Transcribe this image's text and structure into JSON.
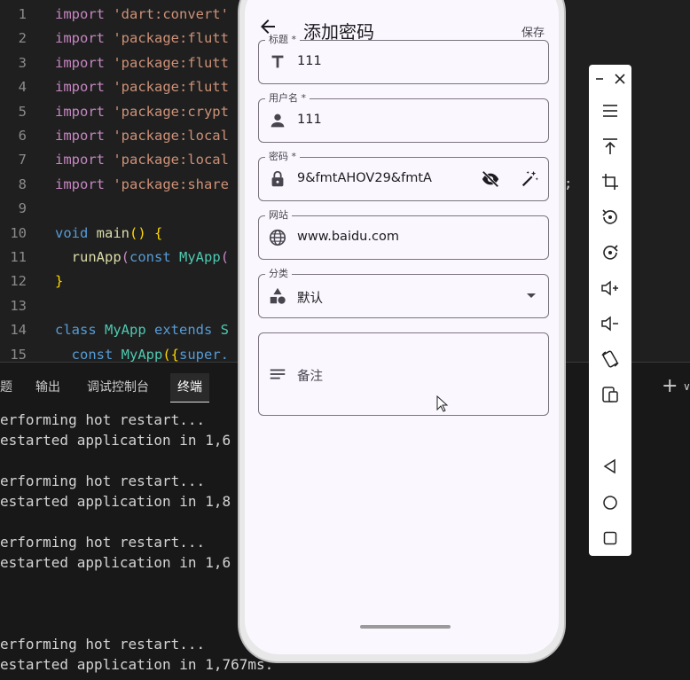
{
  "editor": {
    "lines": [
      {
        "n": "1",
        "parts": [
          [
            "kw",
            "import "
          ],
          [
            "str",
            "'dart:convert'"
          ]
        ]
      },
      {
        "n": "2",
        "parts": [
          [
            "kw",
            "import "
          ],
          [
            "str",
            "'package:flutt"
          ]
        ]
      },
      {
        "n": "3",
        "parts": [
          [
            "kw",
            "import "
          ],
          [
            "str",
            "'package:flutt"
          ]
        ]
      },
      {
        "n": "4",
        "parts": [
          [
            "kw",
            "import "
          ],
          [
            "str",
            "'package:flutt"
          ]
        ]
      },
      {
        "n": "5",
        "parts": [
          [
            "kw",
            "import "
          ],
          [
            "str",
            "'package:crypt"
          ]
        ]
      },
      {
        "n": "6",
        "parts": [
          [
            "kw",
            "import "
          ],
          [
            "str",
            "'package:local"
          ]
        ]
      },
      {
        "n": "7",
        "parts": [
          [
            "kw",
            "import "
          ],
          [
            "str",
            "'package:local"
          ]
        ]
      },
      {
        "n": "8",
        "parts": [
          [
            "kw",
            "import "
          ],
          [
            "str",
            "'package:share"
          ]
        ]
      },
      {
        "n": "9",
        "parts": []
      },
      {
        "n": "10",
        "parts": [
          [
            "kw2",
            "void "
          ],
          [
            "fn",
            "main"
          ],
          [
            "br",
            "() {"
          ]
        ]
      },
      {
        "n": "11",
        "parts": [
          [
            "txt",
            "  "
          ],
          [
            "fn",
            "runApp"
          ],
          [
            "kw",
            "("
          ],
          [
            "kw2",
            "const "
          ],
          [
            "cls",
            "MyApp"
          ],
          [
            "kw",
            "("
          ]
        ]
      },
      {
        "n": "12",
        "parts": [
          [
            "br",
            "}"
          ]
        ]
      },
      {
        "n": "13",
        "parts": []
      },
      {
        "n": "14",
        "parts": [
          [
            "kw2",
            "class "
          ],
          [
            "cls",
            "MyApp "
          ],
          [
            "kw2",
            "extends "
          ],
          [
            "cls",
            "S"
          ]
        ]
      },
      {
        "n": "15",
        "parts": [
          [
            "txt",
            "  "
          ],
          [
            "kw2",
            "const "
          ],
          [
            "cls",
            "MyApp"
          ],
          [
            "br",
            "({"
          ],
          [
            "kw2",
            "super."
          ]
        ]
      }
    ],
    "trailing": ";"
  },
  "panel": {
    "tabs": [
      "题",
      "输出",
      "调试控制台",
      "终端"
    ],
    "active_tab": "终端",
    "add_symbol": "+",
    "dropdown_symbol": "∨",
    "terminal_lines": [
      "erforming hot restart...",
      "estarted application in 1,6",
      "",
      "erforming hot restart...",
      "estarted application in 1,8",
      "",
      "erforming hot restart...",
      "estarted application in 1,6",
      "",
      "",
      "",
      "erforming hot restart...",
      "estarted application in 1,767ms."
    ]
  },
  "app": {
    "title": "添加密码",
    "save_label": "保存",
    "fields": {
      "title": {
        "label": "标题 *",
        "value": "111",
        "icon": "title-icon"
      },
      "username": {
        "label": "用户名 *",
        "value": "111",
        "icon": "person-icon"
      },
      "password": {
        "label": "密码 *",
        "value": "9&fmtAHOV29&fmtA",
        "icon": "lock-icon"
      },
      "website": {
        "label": "网站",
        "value": "www.baidu.com",
        "icon": "globe-icon"
      },
      "category": {
        "label": "分类",
        "value": "默认",
        "icon": "category-icon"
      },
      "notes": {
        "placeholder": "备注",
        "icon": "notes-icon"
      }
    }
  },
  "colors": {
    "app_bg": "#fbf7fe",
    "outline": "#79747e",
    "on_surface": "#1d1b20"
  }
}
